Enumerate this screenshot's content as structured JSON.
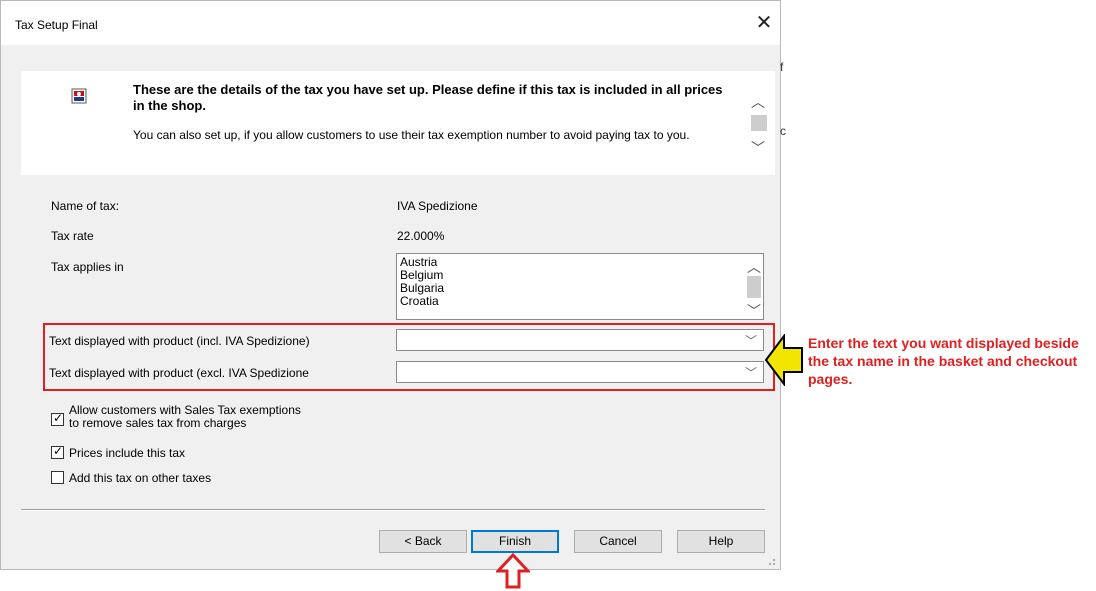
{
  "window": {
    "title": "Tax Setup Final",
    "close_glyph": "✕"
  },
  "background_bleed": {
    "char1": "f",
    "char2": "c"
  },
  "info": {
    "icon": "tax-wizard-icon",
    "bold_text": "These are the details of the tax you have set up. Please define if this tax is included in all prices in the shop.",
    "text": "You can also set up, if you allow customers to use their tax exemption number to avoid paying tax to you."
  },
  "fields": {
    "name_label": "Name of tax:",
    "name_value": "IVA Spedizione",
    "rate_label": "Tax rate",
    "rate_value": "22.000%",
    "applies_label": "Tax applies in",
    "countries": [
      "Austria",
      "Belgium",
      "Bulgaria",
      "Croatia"
    ]
  },
  "text_fields": {
    "incl_label": "Text displayed with product (incl. IVA Spedizione)",
    "incl_value": "",
    "excl_label": "Text displayed with product (excl. IVA Spedizione",
    "excl_value": ""
  },
  "checkboxes": {
    "exemption_line1": "Allow customers with Sales Tax exemptions",
    "exemption_line2": "to remove sales tax from charges",
    "exemption_checked": true,
    "prices_include": "Prices include this tax",
    "prices_include_checked": true,
    "add_on_other": "Add this tax on other taxes",
    "add_on_other_checked": false
  },
  "buttons": {
    "back": "< Back",
    "finish": "Finish",
    "cancel": "Cancel",
    "help": "Help"
  },
  "annotation": {
    "text": "Enter the text you want displayed beside the tax name in the basket and checkout pages.",
    "color": "#e02020",
    "arrow_color": "#f2e600"
  }
}
